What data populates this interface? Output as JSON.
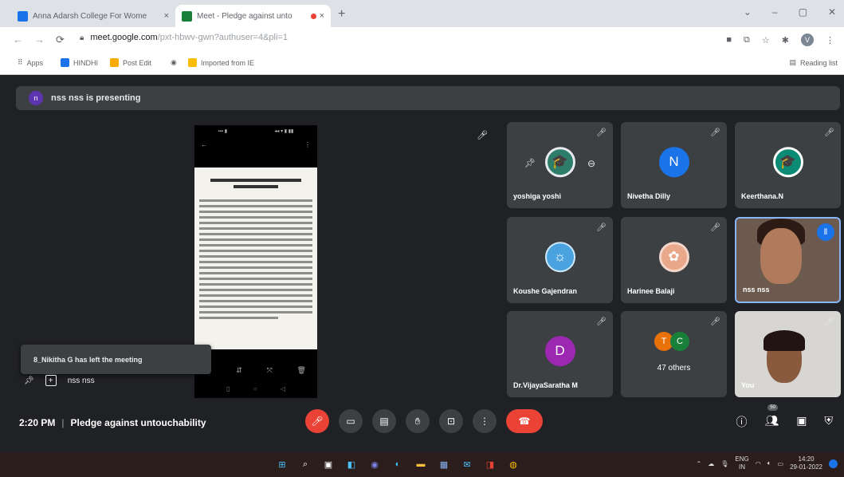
{
  "browser": {
    "tabs": [
      {
        "label": "Anna Adarsh College For Wome",
        "close": "×",
        "icon_color": "#1a73e8"
      },
      {
        "label": "Meet - Pledge against unto",
        "close": "×",
        "icon_color": "#188038",
        "recording_dot": "#ea4335"
      }
    ],
    "new_tab": "+",
    "window_controls": [
      "⌄",
      "–",
      "▢",
      "✕"
    ],
    "url_host": "meet.google.com",
    "url_rest": "/pxt-hbwv-gwn?authuser=4&pli=1",
    "bookmarks": [
      {
        "label": "Apps",
        "color": "#5f6368"
      },
      {
        "label": "HINDHI",
        "color": "#1a73e8"
      },
      {
        "label": "Post Edit",
        "color": "#f9ab00"
      },
      {
        "label": "",
        "color": "#5f6368"
      },
      {
        "label": "Imported from IE",
        "color": "#fbbc04"
      }
    ],
    "reading_list": "Reading list",
    "profile_initial": "V"
  },
  "meet": {
    "presenting_initial": "n",
    "presenting_text": "nss nss is presenting",
    "toast": "8_Nikitha G has left the meeting",
    "pin_name": "nss nss",
    "participants": [
      {
        "name": "yoshiga yoshi",
        "avatar_color": "#2e7d6b"
      },
      {
        "name": "Nivetha Dilly",
        "initial": "N",
        "avatar_color": "#1a73e8"
      },
      {
        "name": "Keerthana.N",
        "avatar_color": "#0b8a74"
      },
      {
        "name": "Koushe Gajendran",
        "avatar_color": "#4aa3df"
      },
      {
        "name": "Harinee Balaji",
        "avatar_color": "#e9a88a"
      },
      {
        "name": "nss nss",
        "avatar_color": ""
      },
      {
        "name": "Dr.VijayaSaratha M",
        "initial": "D",
        "avatar_color": "#9c27b0"
      },
      {
        "name": "47 others",
        "initials": [
          "T",
          "C"
        ],
        "avatar_colors": [
          "#e8710a",
          "#188038"
        ]
      },
      {
        "name": "You",
        "avatar_color": ""
      }
    ],
    "time": "2:20 PM",
    "meeting_title": "Pledge against untouchability",
    "people_badge": "50"
  },
  "taskbar": {
    "lang_top": "ENG",
    "lang_bottom": "IN",
    "time": "14:20",
    "date": "29-01-2022"
  }
}
